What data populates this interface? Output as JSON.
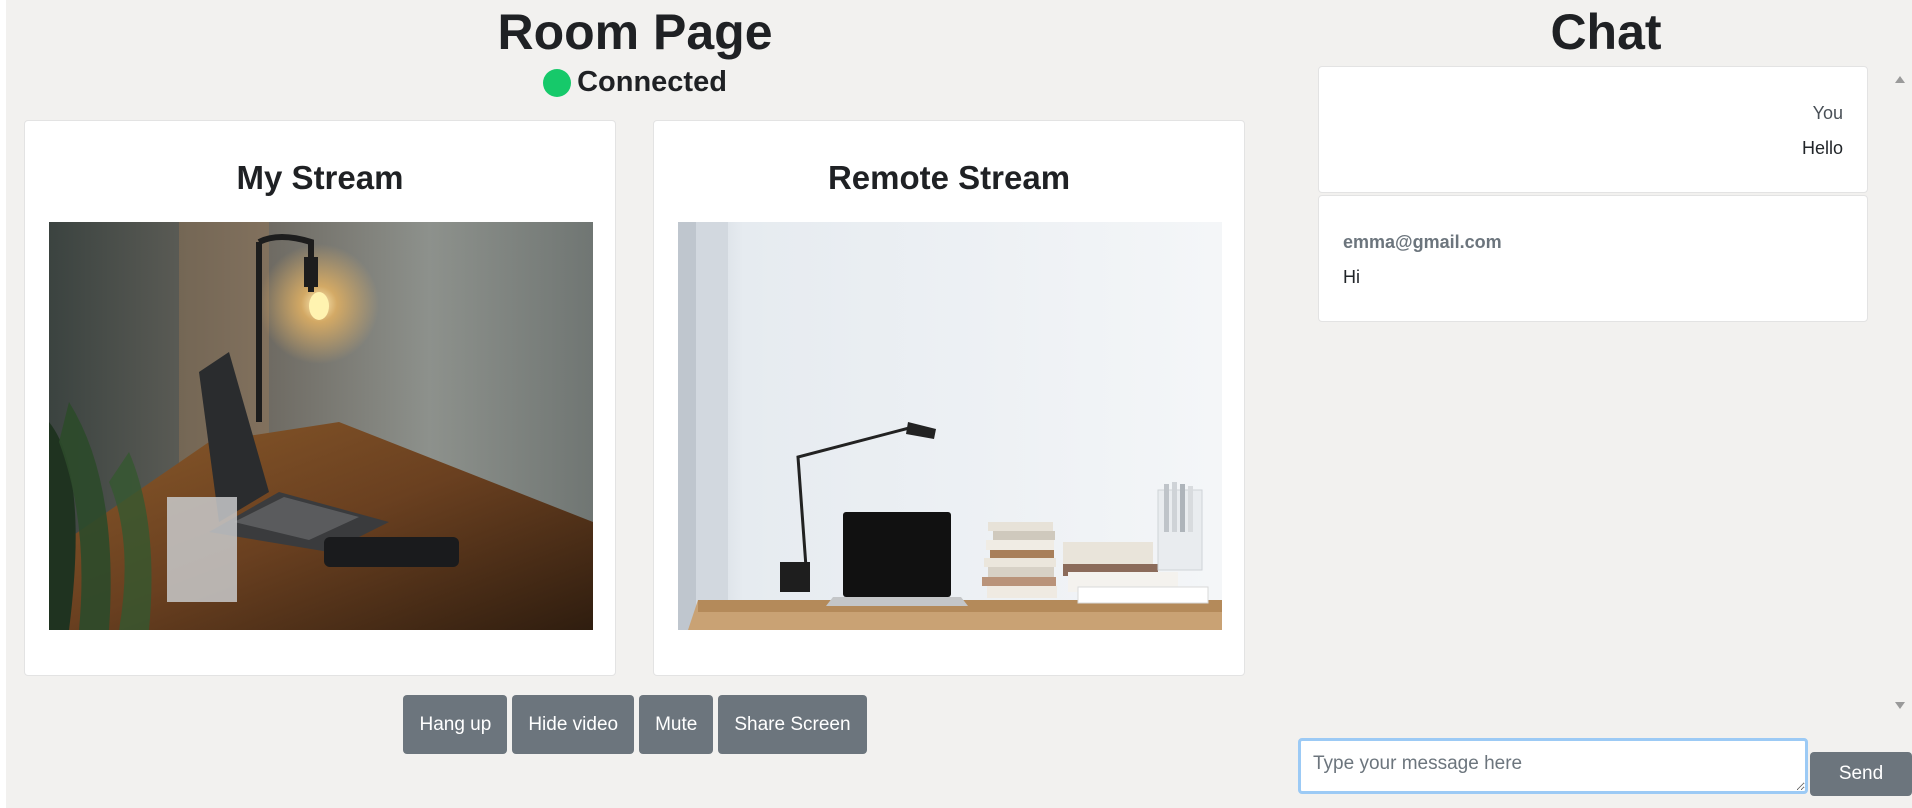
{
  "room": {
    "title": "Room Page",
    "status_label": "Connected",
    "status_color": "#16c96a"
  },
  "streams": {
    "my_title": "My Stream",
    "remote_title": "Remote Stream"
  },
  "controls": {
    "hang_up": "Hang up",
    "hide_video": "Hide video",
    "mute": "Mute",
    "share_screen": "Share Screen"
  },
  "chat": {
    "title": "Chat",
    "messages": [
      {
        "sender": "You",
        "text": "Hello",
        "mine": true
      },
      {
        "sender": "emma@gmail.com",
        "text": "Hi",
        "mine": false
      }
    ],
    "input_placeholder": "Type your message here",
    "send_label": "Send"
  },
  "colors": {
    "button_bg": "#6c757d",
    "background": "#f2f1ef",
    "input_focus_border": "#9ccaf5"
  }
}
